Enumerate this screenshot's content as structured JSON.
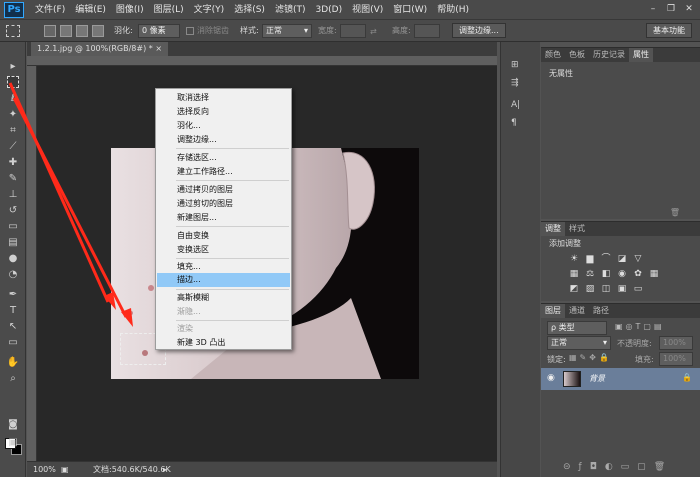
{
  "app": {
    "logo": "Ps"
  },
  "menubar": {
    "items": [
      "文件(F)",
      "编辑(E)",
      "图像(I)",
      "图层(L)",
      "文字(Y)",
      "选择(S)",
      "滤镜(T)",
      "3D(D)",
      "视图(V)",
      "窗口(W)",
      "帮助(H)"
    ]
  },
  "options_bar": {
    "feather_label": "羽化:",
    "feather_value": "0 像素",
    "antialias_label": "消除锯齿",
    "style_label": "样式:",
    "style_value": "正常",
    "width_label": "宽度:",
    "height_label": "高度:",
    "refine_button": "调整边缘...",
    "workspace": "基本功能"
  },
  "document": {
    "tab_title": "1.2.1.jpg @ 100%(RGB/8#) *",
    "zoom": "100%",
    "doc_info": "文档:540.6K/540.6K"
  },
  "context_menu": {
    "items": [
      "取消选择",
      "选择反向",
      "羽化...",
      "调整边缘...",
      "存储选区...",
      "建立工作路径...",
      "通过拷贝的图层",
      "通过剪切的图层",
      "新建图层...",
      "自由变换",
      "变换选区",
      "填充...",
      "描边...",
      "高斯模糊",
      "渐隐...",
      "渲染",
      "新建 3D 凸出"
    ],
    "highlighted": "描边..."
  },
  "panels": {
    "props_tabs": [
      "颜色",
      "色板",
      "历史记录",
      "属性"
    ],
    "props_content": "无属性",
    "adj_tabs": [
      "调整",
      "样式"
    ],
    "adj_title": "添加调整",
    "layers_tabs": [
      "图层",
      "通道",
      "路径"
    ],
    "layers_kind": "ρ 类型",
    "blend_mode": "正常",
    "opacity_label": "不透明度:",
    "opacity_value": "100%",
    "lock_label": "锁定:",
    "fill_label": "填充:",
    "fill_value": "100%",
    "layer_name": "背景"
  }
}
